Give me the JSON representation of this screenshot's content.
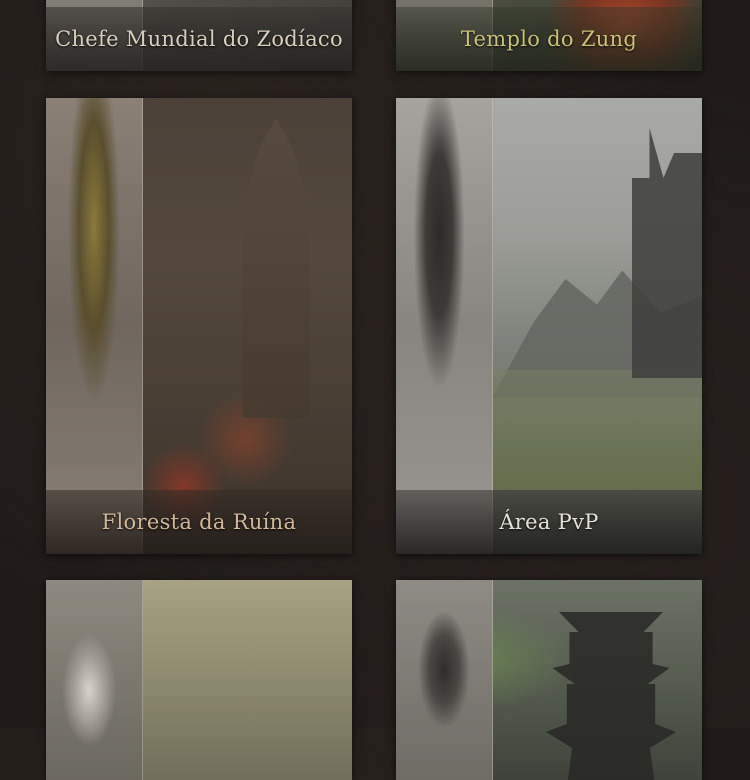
{
  "cards": [
    {
      "id": "chefe",
      "title": "Chefe Mundial do Zodíaco",
      "title_color": "#d8cfbd"
    },
    {
      "id": "templo",
      "title": "Templo do Zung",
      "title_color": "#c9c07a"
    },
    {
      "id": "floresta",
      "title": "Floresta da Ruína",
      "title_color": "#d2b89a"
    },
    {
      "id": "pvp",
      "title": "Área PvP",
      "title_color": "#e6e1d8"
    },
    {
      "id": "bottom-left",
      "title": ""
    },
    {
      "id": "bottom-right",
      "title": ""
    }
  ],
  "colors": {
    "background": "#201b19"
  }
}
